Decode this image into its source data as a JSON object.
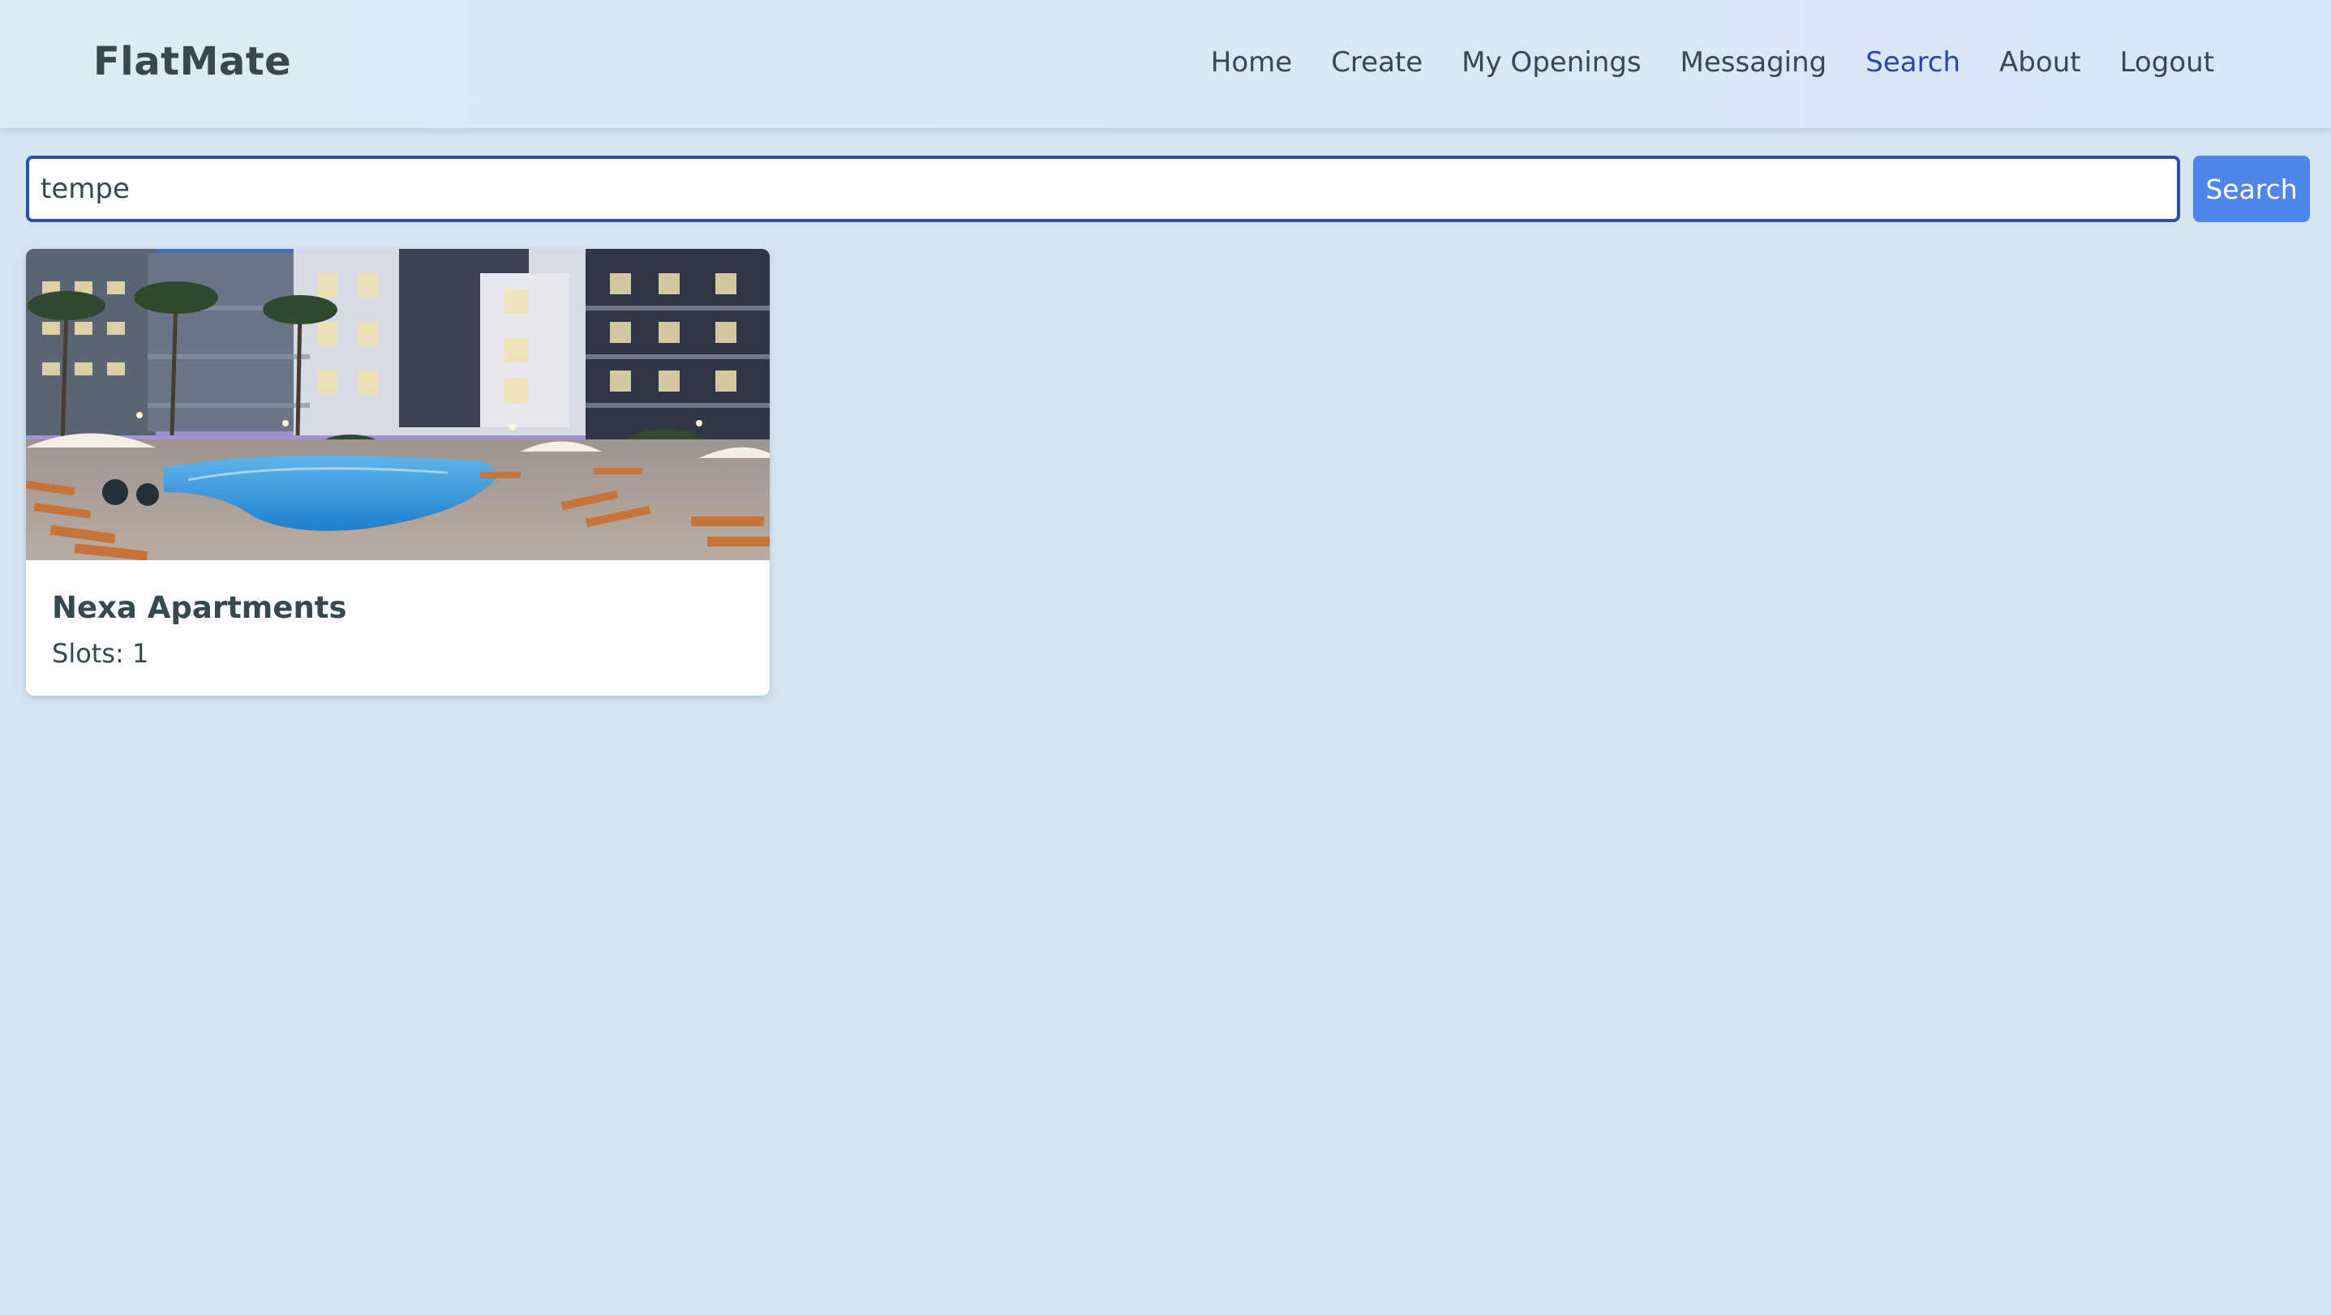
{
  "app": {
    "brand": "FlatMate"
  },
  "nav": {
    "items": [
      {
        "label": "Home",
        "active": false
      },
      {
        "label": "Create",
        "active": false
      },
      {
        "label": "My Openings",
        "active": false
      },
      {
        "label": "Messaging",
        "active": false
      },
      {
        "label": "Search",
        "active": true
      },
      {
        "label": "About",
        "active": false
      },
      {
        "label": "Logout",
        "active": false
      }
    ]
  },
  "search": {
    "value": "tempe",
    "button_label": "Search"
  },
  "results": [
    {
      "title": "Nexa Apartments",
      "slots_text": "Slots: 1",
      "image_icon": "apartment-pool-photo"
    }
  ],
  "colors": {
    "page_background": "#d4e5f2",
    "active_link": "#2b45ad",
    "search_button": "#4f86ea",
    "input_border": "#2b4fa3"
  }
}
